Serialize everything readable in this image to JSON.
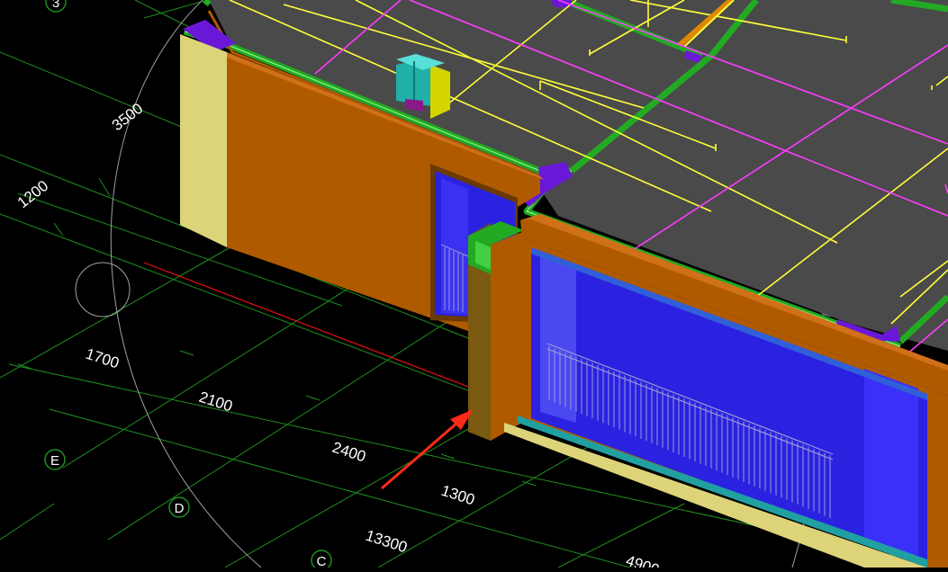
{
  "viewport": {
    "name": "cad-3d-model-view",
    "colors": {
      "background": "#000000",
      "grid": "#1f8f1f",
      "slab": "#4a4a4a",
      "wall_orange": "#b05a00",
      "wall_end_cream": "#ddd47a",
      "glass_blue": "#2a22e0",
      "railing": "#9a9ad8",
      "pipe_yellow": "#ffff3a",
      "pipe_magenta": "#ff3cff",
      "beam_green": "#22aa22",
      "column_cyan": "#20b0a8",
      "column_yellow": "#d4d400",
      "purple_edge": "#6a18d8",
      "arrow_red": "#ff2a1a",
      "section_line_red": "#ee1111",
      "orbit_circle": "#9a9a9a"
    }
  },
  "dimensions": {
    "d3500": "3500",
    "d1200": "1200",
    "d1700": "1700",
    "d2100": "2100",
    "d2400": "2400",
    "d1300": "1300",
    "d13300": "13300",
    "d4900": "4900"
  },
  "axis_bubbles": {
    "a3": "3",
    "aE": "E",
    "aD": "D",
    "aC": "C"
  }
}
